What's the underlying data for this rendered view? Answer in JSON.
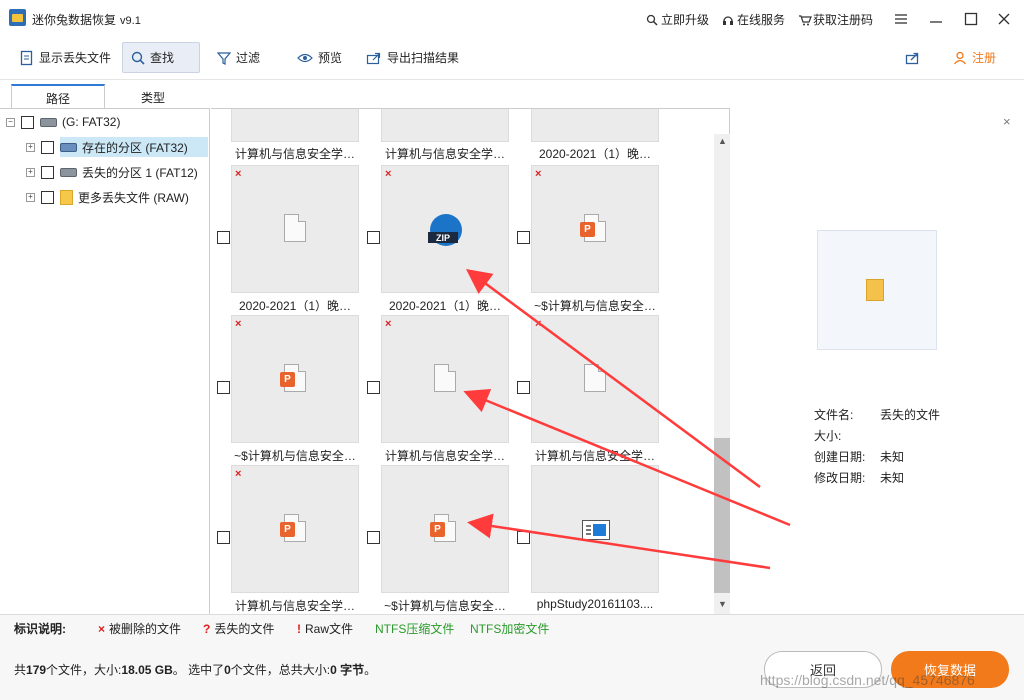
{
  "window": {
    "title": "迷你兔数据恢复",
    "version": "v9.1",
    "links": [
      "立即升级",
      "在线服务",
      "获取注册码"
    ]
  },
  "toolbar": {
    "show_lost": "显示丢失文件",
    "find": "查找",
    "filter": "过滤",
    "preview": "预览",
    "export": "导出扫描结果",
    "register": "注册"
  },
  "tabs": [
    "路径",
    "类型"
  ],
  "tree": {
    "root": "(G: FAT32)",
    "items": [
      "存在的分区 (FAT32)",
      "丢失的分区 1 (FAT12)",
      "更多丢失文件 (RAW)"
    ]
  },
  "grid": {
    "top_names": [
      "计算机与信息安全学…",
      "计算机与信息安全学…",
      "2020-2021（1）晚…"
    ],
    "cells": [
      {
        "name": "2020-2021（1）晚…",
        "icon": "blank-doc-icon",
        "deleted": true
      },
      {
        "name": "2020-2021（1）晚…",
        "icon": "zip-icon",
        "deleted": true
      },
      {
        "name": "~$计算机与信息安全…",
        "icon": "ppt-doc-icon",
        "deleted": true
      },
      {
        "name": "~$计算机与信息安全…",
        "icon": "ppt-doc-icon",
        "deleted": true
      },
      {
        "name": "计算机与信息安全学…",
        "icon": "blank-doc-icon",
        "deleted": true
      },
      {
        "name": "计算机与信息安全学…",
        "icon": "blank-doc-icon",
        "deleted": true
      },
      {
        "name": "计算机与信息安全学…",
        "icon": "ppt-doc-icon",
        "deleted": true
      },
      {
        "name": "~$计算机与信息安全…",
        "icon": "ppt-doc-icon",
        "deleted": false
      },
      {
        "name": "phpStudy20161103....",
        "icon": "window-icon",
        "deleted": false
      }
    ]
  },
  "preview": {
    "labels": [
      "文件名:",
      "大小:",
      "创建日期:",
      "修改日期:"
    ],
    "values": [
      "丢失的文件",
      "",
      "未知",
      "未知"
    ]
  },
  "legend": {
    "title": "标识说明:",
    "deleted": "被删除的文件",
    "lost": "丢失的文件",
    "raw": "Raw文件",
    "ntfs_compressed": "NTFS压缩文件",
    "ntfs_encrypted": "NTFS加密文件"
  },
  "status": {
    "total_prefix": "共",
    "total_files": "179",
    "total_suffix": "个文件，大小:",
    "total_size": "18.05 GB",
    "selected_prefix": "。 选中了",
    "selected_count": "0",
    "selected_mid": "个文件，总共大小:",
    "selected_size": "0 字节",
    "end": "。"
  },
  "buttons": {
    "back": "返回",
    "recover": "恢复数据"
  },
  "watermark": "https://blog.csdn.net/qq_45746876",
  "colors": {
    "accent": "#f27a1a",
    "delete_mark": "#e02020",
    "ntfs": "#2a9a2a",
    "select": "#cce8f6"
  }
}
